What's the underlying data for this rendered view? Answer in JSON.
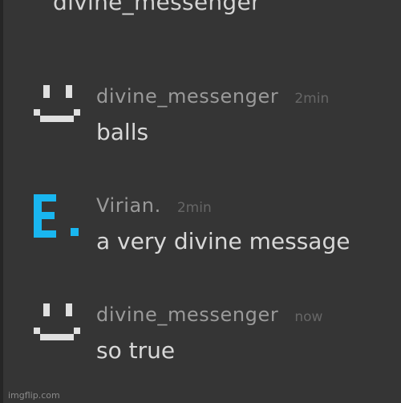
{
  "chat": {
    "top_partial_username": "divine_messenger",
    "messages": [
      {
        "avatar_icon": "pixel-smiley-icon",
        "avatar_color": "#e0e0e0",
        "username": "divine_messenger",
        "timestamp": "2min",
        "text": "balls"
      },
      {
        "avatar_icon": "pixel-e-letter-icon",
        "avatar_color": "#19b6f0",
        "username": "Virian.",
        "timestamp": "2min",
        "text": "a very divine message"
      },
      {
        "avatar_icon": "pixel-smiley-icon",
        "avatar_color": "#e0e0e0",
        "username": "divine_messenger",
        "timestamp": "now",
        "text": "so true"
      }
    ]
  },
  "watermark": "imgflip.com",
  "colors": {
    "background": "#353535",
    "username": "#9a9a9a",
    "timestamp": "#666666",
    "message_text": "#d8d8d8"
  }
}
